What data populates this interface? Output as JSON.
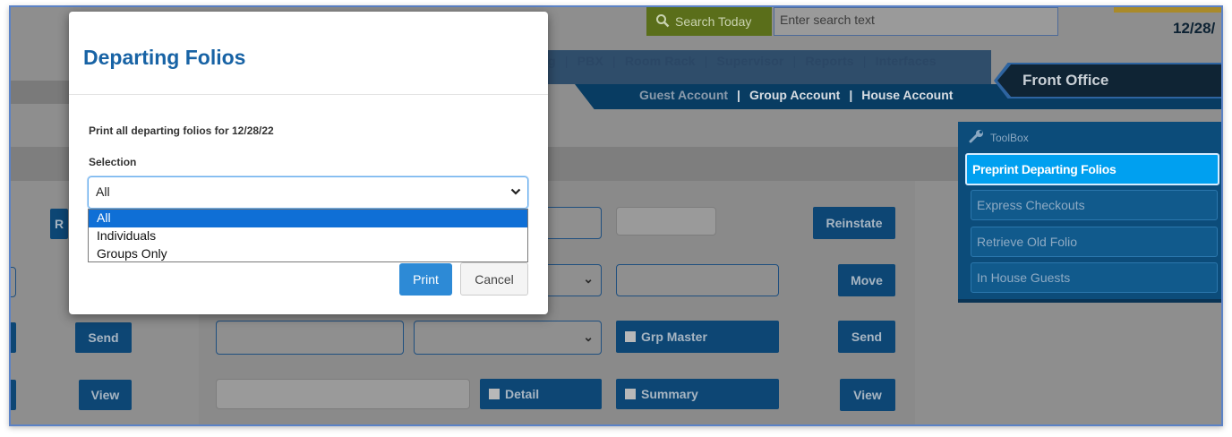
{
  "header": {
    "search_button_label": "Search Today",
    "search_placeholder": "Enter search text",
    "date": "12/28/"
  },
  "menu": {
    "items": [
      "g",
      "PBX",
      "Room Rack",
      "Supervisor",
      "Reports",
      "Interfaces"
    ]
  },
  "accounts": {
    "items": [
      "Guest Account",
      "Group Account",
      "House Account"
    ]
  },
  "section": {
    "title": "Front Office"
  },
  "background_buttons": {
    "reinstate": "Reinstate",
    "move": "Move",
    "send": "Send",
    "view": "View",
    "grp_master": "Grp Master",
    "detail": "Detail",
    "summary": "Summary",
    "r_partial": "R"
  },
  "toolbox": {
    "title": "ToolBox",
    "items": [
      "Preprint Departing Folios",
      "Express Checkouts",
      "Retrieve Old Folio",
      "In House Guests"
    ],
    "active_index": 0
  },
  "modal": {
    "title": "Departing Folios",
    "message": "Print all departing folios for 12/28/22",
    "selection_label": "Selection",
    "selected_value": "All",
    "options": [
      "All",
      "Individuals",
      "Groups Only"
    ],
    "print_label": "Print",
    "cancel_label": "Cancel"
  },
  "colors": {
    "modal_title": "#1863a5",
    "primary_button": "#2d8ad6",
    "toolbox_active": "#00a0f0",
    "dropdown_highlight": "#0f6fd6"
  }
}
